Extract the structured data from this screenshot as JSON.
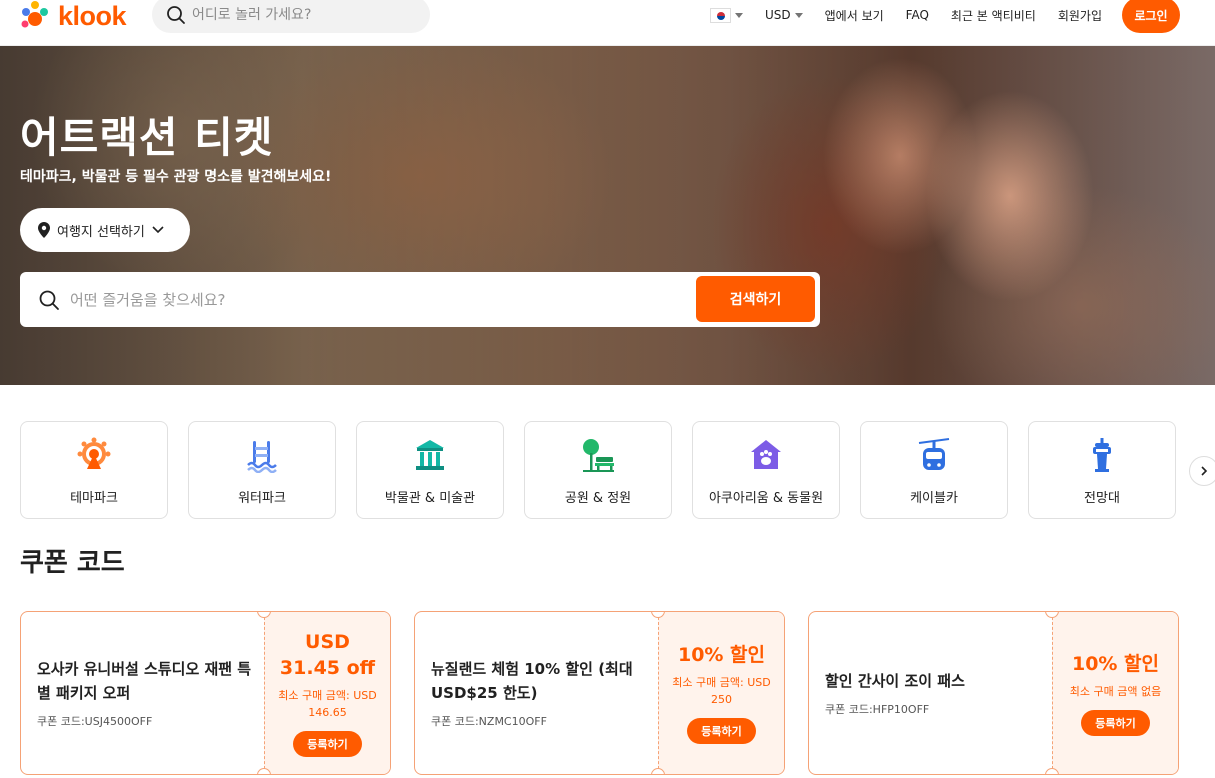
{
  "header": {
    "logo_text": "klook",
    "search_placeholder": "어디로 놀러 가세요?",
    "currency": "USD",
    "nav": {
      "app": "앱에서 보기",
      "faq": "FAQ",
      "recent": "최근 본 액티비티",
      "signup": "회원가입",
      "login": "로그인"
    }
  },
  "hero": {
    "title": "어트랙션 티켓",
    "subtitle": "테마파크, 박물관 등 필수 관광 명소를 발견해보세요!",
    "destination_label": "여행지 선택하기",
    "search_placeholder": "어떤 즐거움을 찾으세요?",
    "search_button": "검색하기"
  },
  "categories": [
    {
      "label": "테마파크",
      "icon": "ferris-wheel-icon"
    },
    {
      "label": "워터파크",
      "icon": "pool-ladder-icon"
    },
    {
      "label": "박물관 & 미술관",
      "icon": "museum-icon"
    },
    {
      "label": "공원 & 정원",
      "icon": "park-bench-icon"
    },
    {
      "label": "아쿠아리움 & 동물원",
      "icon": "paw-house-icon"
    },
    {
      "label": "케이블카",
      "icon": "cable-car-icon"
    },
    {
      "label": "전망대",
      "icon": "observation-tower-icon"
    }
  ],
  "coupons_section": {
    "title": "쿠폰 코드",
    "coupons": [
      {
        "title": "오사카 유니버설 스튜디오 재팬 특별 패키지 오퍼",
        "code": "쿠폰 코드:USJ4500OFF",
        "amount": "USD 31.45 off",
        "min": "최소 구매 금액: USD 146.65",
        "button": "등록하기"
      },
      {
        "title": "뉴질랜드 체험 10% 할인 (최대 USD$25 한도)",
        "code": "쿠폰 코드:NZMC10OFF",
        "amount": "10% 할인",
        "min": "최소 구매 금액: USD 250",
        "button": "등록하기"
      },
      {
        "title": "할인 간사이 조이 패스",
        "code": "쿠폰 코드:HFP10OFF",
        "amount": "10% 할인",
        "min": "최소 구매 금액 없음",
        "button": "등록하기"
      }
    ]
  },
  "colors": {
    "brand": "#ff5b00",
    "coupon_bg": "#fff3ec",
    "coupon_border": "#f5a276"
  }
}
